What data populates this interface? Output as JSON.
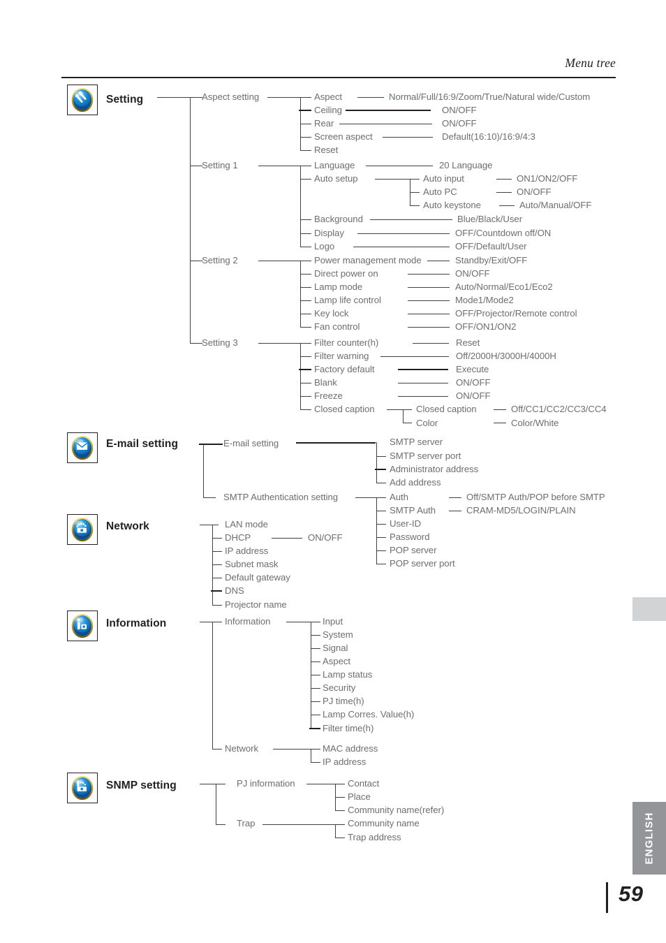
{
  "page": {
    "header_title": "Menu tree",
    "page_number": "59",
    "language_tab": "ENGLISH"
  },
  "sections": [
    {
      "id": "setting",
      "title": "Setting",
      "icon": "settings-tools-icon",
      "groups": [
        {
          "label": "Aspect setting",
          "items": [
            {
              "label": "Aspect",
              "value": "Normal/Full/16:9/Zoom/True/Natural wide/Custom"
            },
            {
              "label": "Ceiling",
              "value": "ON/OFF"
            },
            {
              "label": "Rear",
              "value": "ON/OFF"
            },
            {
              "label": "Screen aspect",
              "value": "Default(16:10)/16:9/4:3"
            },
            {
              "label": "Reset",
              "value": ""
            }
          ]
        },
        {
          "label": "Setting 1",
          "items": [
            {
              "label": "Language",
              "value": "20 Language"
            },
            {
              "label": "Auto setup",
              "value": "",
              "children": [
                {
                  "label": "Auto input",
                  "value": "ON1/ON2/OFF"
                },
                {
                  "label": "Auto PC",
                  "value": "ON/OFF"
                },
                {
                  "label": "Auto keystone",
                  "value": "Auto/Manual/OFF"
                }
              ]
            },
            {
              "label": "Background",
              "value": "Blue/Black/User"
            },
            {
              "label": "Display",
              "value": "OFF/Countdown off/ON"
            },
            {
              "label": "Logo",
              "value": "OFF/Default/User"
            }
          ]
        },
        {
          "label": "Setting 2",
          "items": [
            {
              "label": "Power management mode",
              "value": "Standby/Exit/OFF"
            },
            {
              "label": "Direct power on",
              "value": "ON/OFF"
            },
            {
              "label": "Lamp mode",
              "value": "Auto/Normal/Eco1/Eco2"
            },
            {
              "label": "Lamp life control",
              "value": "Mode1/Mode2"
            },
            {
              "label": "Key lock",
              "value": "OFF/Projector/Remote control"
            },
            {
              "label": "Fan control",
              "value": "OFF/ON1/ON2"
            }
          ]
        },
        {
          "label": "Setting 3",
          "items": [
            {
              "label": "Filter counter(h)",
              "value": "Reset"
            },
            {
              "label": "Filter warning",
              "value": "Off/2000H/3000H/4000H"
            },
            {
              "label": "Factory default",
              "value": "Execute"
            },
            {
              "label": "Blank",
              "value": "ON/OFF"
            },
            {
              "label": "Freeze",
              "value": "ON/OFF"
            },
            {
              "label": "Closed caption",
              "value": "",
              "children": [
                {
                  "label": "Closed caption",
                  "value": "Off/CC1/CC2/CC3/CC4"
                },
                {
                  "label": "Color",
                  "value": "Color/White"
                }
              ]
            }
          ]
        }
      ]
    },
    {
      "id": "email-setting",
      "title": "E-mail setting",
      "icon": "envelope-icon",
      "groups": [
        {
          "label": "E-mail setting",
          "items": [
            {
              "label": "SMTP server",
              "value": ""
            },
            {
              "label": "SMTP server port",
              "value": ""
            },
            {
              "label": "Administrator address",
              "value": ""
            },
            {
              "label": "Add address",
              "value": ""
            }
          ]
        },
        {
          "label": "SMTP Authentication setting",
          "items": [
            {
              "label": "Auth",
              "value": "Off/SMTP Auth/POP before SMTP"
            },
            {
              "label": "SMTP Auth",
              "value": "CRAM-MD5/LOGIN/PLAIN"
            },
            {
              "label": "User-ID",
              "value": ""
            },
            {
              "label": "Password",
              "value": ""
            },
            {
              "label": "POP server",
              "value": ""
            },
            {
              "label": "POP server port",
              "value": ""
            }
          ]
        }
      ]
    },
    {
      "id": "network",
      "title": "Network",
      "icon": "network-lock-icon",
      "groups": [
        {
          "label": "",
          "items": [
            {
              "label": "LAN mode",
              "value": ""
            },
            {
              "label": "DHCP",
              "value": "ON/OFF"
            },
            {
              "label": "IP address",
              "value": ""
            },
            {
              "label": "Subnet mask",
              "value": ""
            },
            {
              "label": "Default gateway",
              "value": ""
            },
            {
              "label": "DNS",
              "value": ""
            },
            {
              "label": "Projector name",
              "value": ""
            }
          ]
        }
      ]
    },
    {
      "id": "information",
      "title": "Information",
      "icon": "information-icon",
      "groups": [
        {
          "label": "Information",
          "items": [
            {
              "label": "Input",
              "value": ""
            },
            {
              "label": "System",
              "value": ""
            },
            {
              "label": "Signal",
              "value": ""
            },
            {
              "label": "Aspect",
              "value": ""
            },
            {
              "label": "Lamp status",
              "value": ""
            },
            {
              "label": "Security",
              "value": ""
            },
            {
              "label": "PJ time(h)",
              "value": ""
            },
            {
              "label": "Lamp Corres. Value(h)",
              "value": ""
            },
            {
              "label": "Filter time(h)",
              "value": ""
            }
          ]
        },
        {
          "label": "Network",
          "items": [
            {
              "label": "MAC address",
              "value": ""
            },
            {
              "label": "IP address",
              "value": ""
            }
          ]
        }
      ]
    },
    {
      "id": "snmp-setting",
      "title": "SNMP setting",
      "icon": "snmp-network-icon",
      "groups": [
        {
          "label": "PJ information",
          "items": [
            {
              "label": "Contact",
              "value": ""
            },
            {
              "label": "Place",
              "value": ""
            },
            {
              "label": "Community name(refer)",
              "value": ""
            }
          ]
        },
        {
          "label": "Trap",
          "items": [
            {
              "label": "Community name",
              "value": ""
            },
            {
              "label": "Trap address",
              "value": ""
            }
          ]
        }
      ]
    }
  ]
}
